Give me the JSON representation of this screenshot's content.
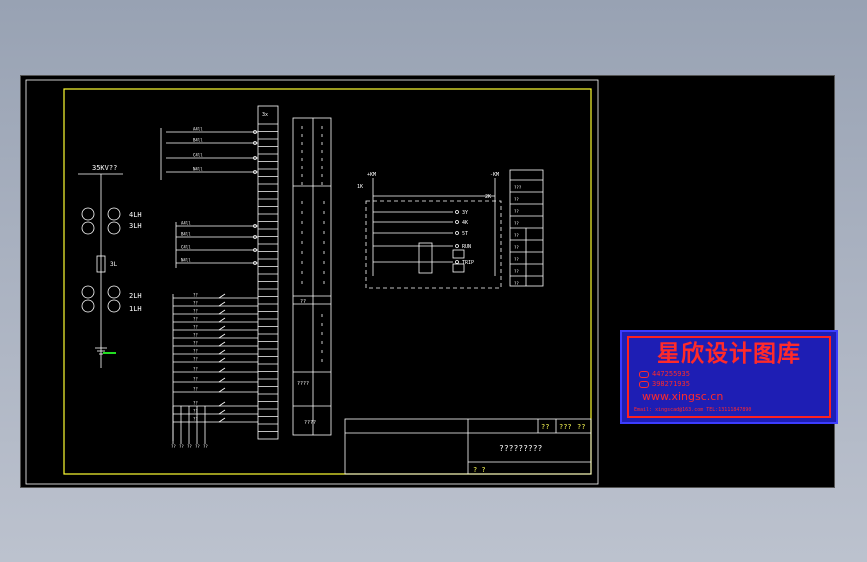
{
  "single_line": {
    "busbar_label": "35KV??",
    "ct_labels": [
      "4LH",
      "3LH",
      "2LH",
      "1LH"
    ],
    "fuse_label": "3L"
  },
  "terminal_block": {
    "header": "3x",
    "top_inputs": [
      "A4ll",
      "B4ll",
      "C4ll",
      "N4ll"
    ],
    "mid_inputs": [
      "A4ll",
      "B4ll",
      "C4ll",
      "N4ll"
    ],
    "lower_labels": [
      "??",
      "??",
      "??",
      "??",
      "??",
      "??",
      "??",
      "??",
      "??",
      "??",
      "??",
      "??",
      "??",
      "??",
      "??"
    ],
    "bottom_codes": [
      "??",
      "??",
      "??",
      "??",
      "??"
    ]
  },
  "legend_table": {
    "mid_label": "??",
    "lower_label": "????",
    "footer_label": "????"
  },
  "control_circuit": {
    "left_source": "+KM",
    "right_source": "-KM",
    "left_tag": "1K",
    "right_tag": "2K",
    "rows": [
      "3Y",
      "4K",
      "5T",
      "RUN",
      "TRIP"
    ],
    "table_rows": [
      "???",
      "??",
      "??",
      "??",
      "??",
      "??",
      "??",
      "??",
      "??"
    ]
  },
  "title_block": {
    "cell_a": "??",
    "cell_b": "???",
    "cell_c": "??",
    "drawing_title": "?????????",
    "sheet_label": "? ?"
  },
  "watermark": {
    "title": "星欣设计图库",
    "qq1": "447255935",
    "qq2": "398271935",
    "website": "www.xingsc.cn",
    "email_line": "Email: xingscad@163.com TEL:13111847890"
  },
  "colors": {
    "drawing_bg": "#000000",
    "frame": "#ffff33",
    "lines": "#ffffff",
    "stamp_bg": "#1e1eb4",
    "stamp_text": "#ff2a2a"
  }
}
